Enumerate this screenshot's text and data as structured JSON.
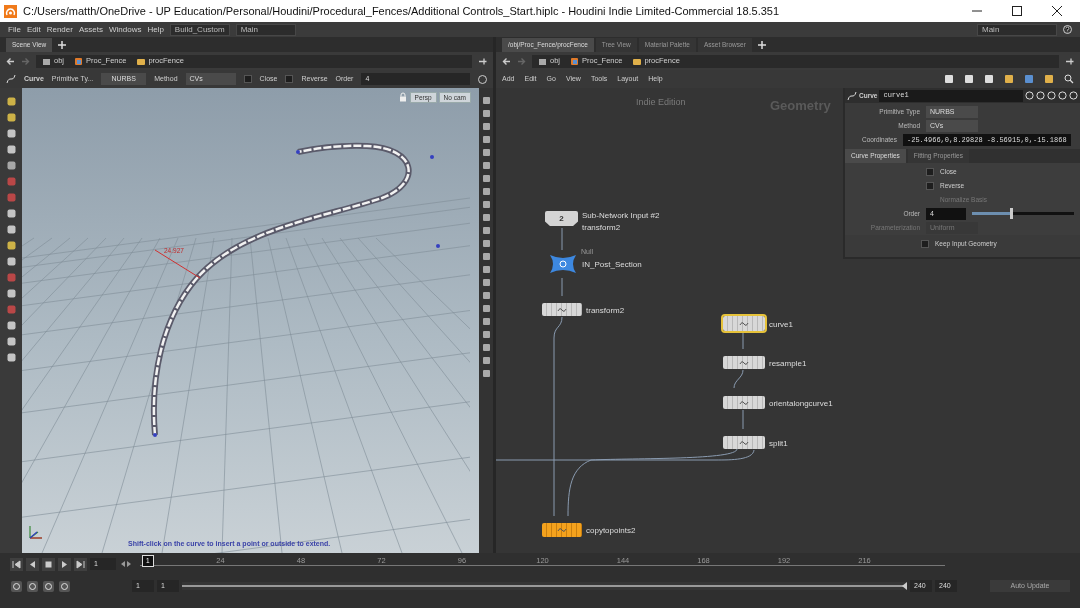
{
  "window": {
    "title": "C:/Users/matth/OneDrive - UP Education/Personal/Houdini/Procedural_Fences/Additional Controls_Start.hiplc - Houdini Indie Limited-Commercial 18.5.351"
  },
  "menu": [
    "File",
    "Edit",
    "Render",
    "Assets",
    "Windows",
    "Help"
  ],
  "desktops": [
    "Build_Custom",
    "Main"
  ],
  "right_desktop": "Main",
  "scene_view": {
    "tabs": [
      {
        "label": "Scene View",
        "selected": true
      }
    ],
    "path": [
      "obj",
      "Proc_Fence",
      "procFence"
    ],
    "tool_options": {
      "tool": "Curve",
      "primitive_label": "Primitive Ty...",
      "primitive_value": "NURBS",
      "method_label": "Method",
      "method_value": "CVs",
      "close": {
        "label": "Close",
        "checked": false
      },
      "reverse": {
        "label": "Reverse",
        "checked": false
      },
      "order_label": "Order",
      "order_value": "4"
    },
    "viewport": {
      "camera": "Persp",
      "cam_menu": "No cam",
      "measurement": "24.927",
      "hint": "Shift-click on the curve to insert a point or outside to extend."
    }
  },
  "network_view": {
    "tabs": [
      {
        "label": "/obj/Proc_Fence/procFence",
        "selected": true
      },
      {
        "label": "Tree View",
        "selected": false
      },
      {
        "label": "Material Palette",
        "selected": false
      },
      {
        "label": "Asset Browser",
        "selected": false
      }
    ],
    "path": [
      "obj",
      "Proc_Fence",
      "procFence"
    ],
    "menu": [
      "Add",
      "Edit",
      "Go",
      "View",
      "Tools",
      "Layout",
      "Help"
    ],
    "edition": "Indie Edition",
    "context": "Geometry",
    "nodes": [
      {
        "kind": "subnet_input",
        "badge": "2",
        "name": "Sub-Network Input #2",
        "subtitle": "transform2",
        "selected": false,
        "display": false
      },
      {
        "kind": "null",
        "type_label": "Null",
        "name": "IN_Post_Section",
        "selected": false,
        "display": false
      },
      {
        "kind": "sop",
        "name": "transform2",
        "selected": false,
        "display": false
      },
      {
        "kind": "sop",
        "name": "curve1",
        "selected": true,
        "display": false
      },
      {
        "kind": "sop",
        "name": "resample1",
        "selected": false,
        "display": false
      },
      {
        "kind": "sop",
        "name": "orientalongcurve1",
        "selected": false,
        "display": false
      },
      {
        "kind": "sop",
        "name": "split1",
        "selected": false,
        "display": false
      },
      {
        "kind": "sop",
        "name": "copytopoints2",
        "selected": false,
        "display": true
      }
    ],
    "params": {
      "type": "Curve",
      "name": "curve1",
      "rows": [
        {
          "label": "Primitive Type",
          "value": "NURBS"
        },
        {
          "label": "Method",
          "value": "CVs"
        }
      ],
      "coords_label": "Coordinates",
      "coords": "-25.4966,0,8.29828 -8.56915,0,-15.1868",
      "tabs": [
        {
          "label": "Curve Properties",
          "selected": true
        },
        {
          "label": "Fitting Properties",
          "selected": false
        }
      ],
      "close": {
        "label": "Close",
        "checked": false
      },
      "reverse": {
        "label": "Reverse",
        "checked": false
      },
      "normalize": {
        "label": "Normalize Basis",
        "disabled": true
      },
      "order": {
        "label": "Order",
        "value": "4",
        "level": 0.38
      },
      "parameterization": {
        "label": "Parameterization",
        "value": "Uniform",
        "disabled": true
      },
      "keep": {
        "label": "Keep Input Geometry",
        "checked": false
      }
    }
  },
  "timeline": {
    "frame": "1",
    "current_frame": "1",
    "ticks": [
      "24",
      "48",
      "72",
      "96",
      "120",
      "144",
      "168",
      "192",
      "216"
    ],
    "range_start": "1",
    "range_start2": "1",
    "range_end": "240",
    "range_end2": "240",
    "range_slider": {
      "level": 1
    },
    "auto_update": "Auto Update"
  }
}
